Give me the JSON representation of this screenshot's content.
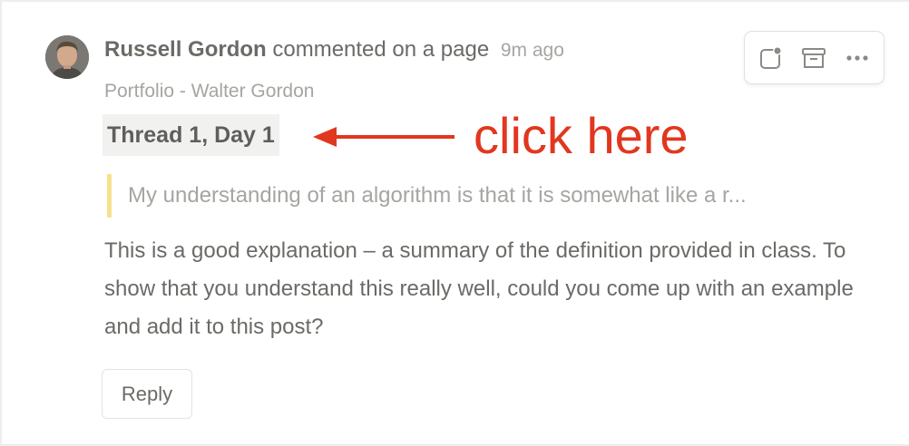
{
  "comment": {
    "author": "Russell Gordon",
    "action": "commented on a page",
    "time": "9m ago",
    "page_path": "Portfolio - Walter Gordon",
    "thread_label": "Thread 1, Day 1",
    "quote": "My understanding of an algorithm is that it is somewhat like a r...",
    "body": "This is a good explanation – a summary of the definition provided in class. To show that you understand this really well, could you come up with an example and add it to this post?",
    "reply_label": "Reply"
  },
  "annotation": {
    "text": "click here",
    "color": "#e1371f"
  },
  "toolbar": {
    "icons": [
      "resolve-icon",
      "archive-icon",
      "more-icon"
    ]
  },
  "colors": {
    "quote_bar": "#f7e18d",
    "thread_tag_bg": "#f1f1ef",
    "text_primary": "#6b6a66",
    "text_muted": "#a6a5a1"
  }
}
